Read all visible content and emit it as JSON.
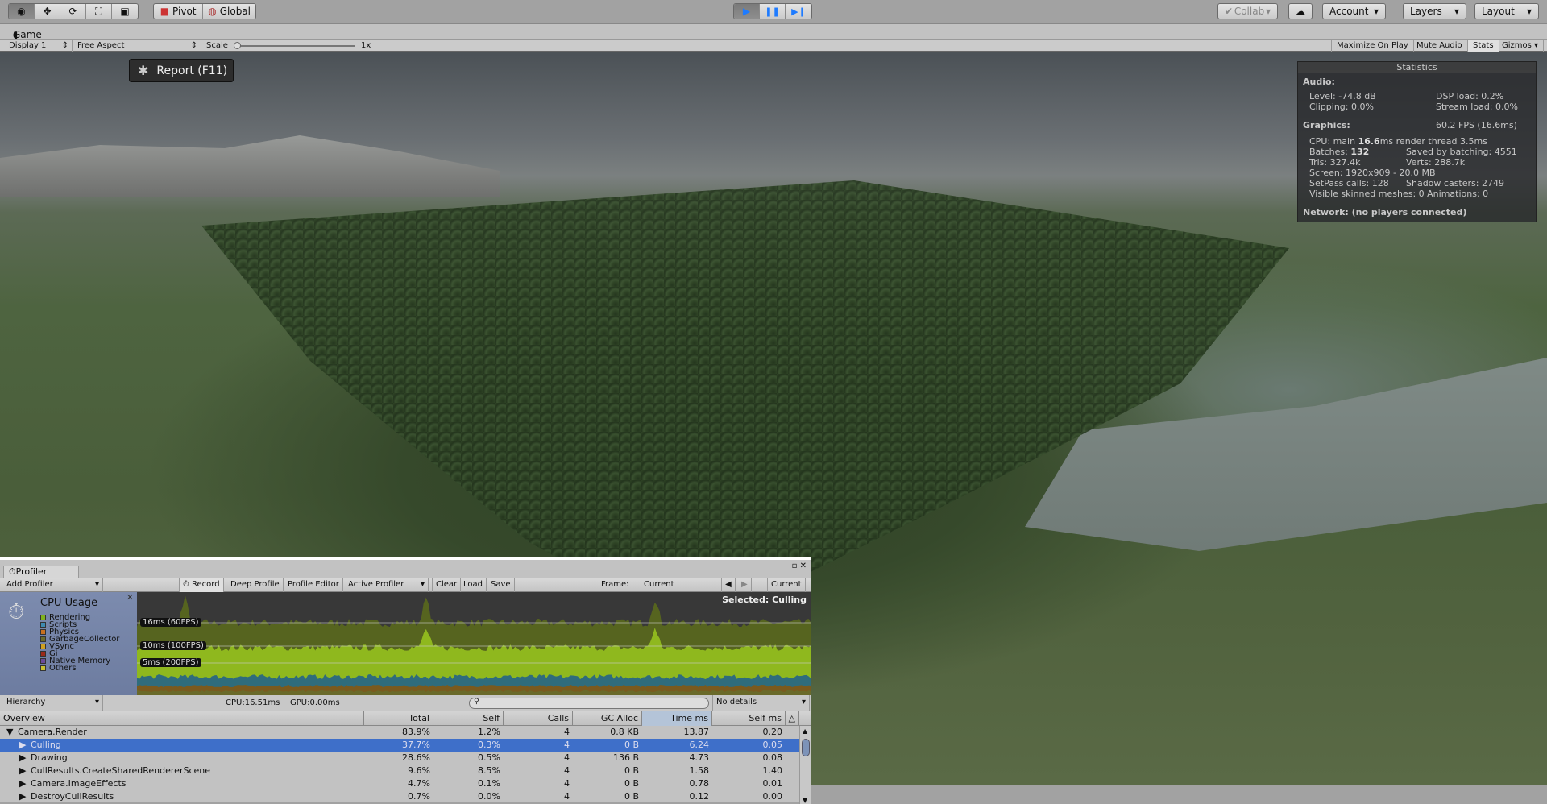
{
  "toolbar": {
    "tools": [
      {
        "name": "view-tool",
        "glyph": "◉"
      },
      {
        "name": "move-tool",
        "glyph": "✥"
      },
      {
        "name": "rotate-tool",
        "glyph": "⟳"
      },
      {
        "name": "scale-tool",
        "glyph": "⛶"
      },
      {
        "name": "rect-tool",
        "glyph": "▣"
      }
    ],
    "pivot": "Pivot",
    "global": "Global",
    "play": "▶",
    "pause": "❚❚",
    "step": "▶❙",
    "collab": "Collab",
    "account": "Account",
    "layers": "Layers",
    "layout": "Layout",
    "accent": "#1e7bff"
  },
  "game": {
    "tab": "Game",
    "display": "Display 1",
    "aspect": "Free Aspect",
    "scale_label": "Scale",
    "scale_value": "1x",
    "maximize": "Maximize On Play",
    "mute": "Mute Audio",
    "stats": "Stats",
    "gizmos": "Gizmos",
    "report": "Report (F11)"
  },
  "statistics": {
    "title": "Statistics",
    "audio": "Audio:",
    "level": "Level: -74.8 dB",
    "dsp": "DSP load: 0.2%",
    "clipping": "Clipping: 0.0%",
    "stream": "Stream load: 0.0%",
    "graphics": "Graphics:",
    "fps": "60.2 FPS (16.6ms)",
    "cpu_pre": "CPU: main ",
    "cpu_val": "16.6",
    "cpu_post": "ms  render thread 3.5ms",
    "batches_pre": "Batches: ",
    "batches_val": "132",
    "saved": "Saved by batching: 4551",
    "tris": "Tris: 327.4k",
    "verts": "Verts: 288.7k",
    "screen": "Screen: 1920x909 - 20.0 MB",
    "setpass": "SetPass calls: 128",
    "shadow": "Shadow casters: 2749",
    "skinned": "Visible skinned meshes: 0  Animations: 0",
    "network": "Network: (no players connected)"
  },
  "profiler": {
    "tab": "Profiler",
    "add": "Add Profiler",
    "record": "Record",
    "deep": "Deep Profile",
    "editor": "Profile Editor",
    "active": "Active Profiler",
    "clear": "Clear",
    "load": "Load",
    "save": "Save",
    "frame_label": "Frame:",
    "frame_value": "Current",
    "current": "Current",
    "cpu_title": "CPU Usage",
    "selected": "Selected: Culling",
    "legend": [
      {
        "label": "Rendering",
        "color": "#7fb21e"
      },
      {
        "label": "Scripts",
        "color": "#3e8ab0"
      },
      {
        "label": "Physics",
        "color": "#c8701e"
      },
      {
        "label": "GarbageCollector",
        "color": "#6a6a2a"
      },
      {
        "label": "VSync",
        "color": "#d0a020"
      },
      {
        "label": "Gi",
        "color": "#9a2a1a"
      },
      {
        "label": "Native Memory",
        "color": "#6a4a9a"
      },
      {
        "label": "Others",
        "color": "#c8c030"
      }
    ],
    "guides": [
      "16ms (60FPS)",
      "10ms (100FPS)",
      "5ms (200FPS)"
    ],
    "view": "Hierarchy",
    "cpu_time": "CPU:16.51ms",
    "gpu_time": "GPU:0.00ms",
    "search_placeholder": "",
    "details": "No details",
    "columns": [
      "Overview",
      "Total",
      "Self",
      "Calls",
      "GC Alloc",
      "Time ms",
      "Self ms"
    ],
    "rows": [
      {
        "name": "Camera.Render",
        "total": "83.9%",
        "self": "1.2%",
        "calls": "4",
        "gc": "0.8 KB",
        "time": "13.87",
        "selfms": "0.20",
        "expanded": true,
        "depth": 0
      },
      {
        "name": "Culling",
        "total": "37.7%",
        "self": "0.3%",
        "calls": "4",
        "gc": "0 B",
        "time": "6.24",
        "selfms": "0.05",
        "depth": 1,
        "selected": true
      },
      {
        "name": "Drawing",
        "total": "28.6%",
        "self": "0.5%",
        "calls": "4",
        "gc": "136 B",
        "time": "4.73",
        "selfms": "0.08",
        "depth": 1
      },
      {
        "name": "CullResults.CreateSharedRendererScene",
        "total": "9.6%",
        "self": "8.5%",
        "calls": "4",
        "gc": "0 B",
        "time": "1.58",
        "selfms": "1.40",
        "depth": 1
      },
      {
        "name": "Camera.ImageEffects",
        "total": "4.7%",
        "self": "0.1%",
        "calls": "4",
        "gc": "0 B",
        "time": "0.78",
        "selfms": "0.01",
        "depth": 1
      },
      {
        "name": "DestroyCullResults",
        "total": "0.7%",
        "self": "0.0%",
        "calls": "4",
        "gc": "0 B",
        "time": "0.12",
        "selfms": "0.00",
        "depth": 1
      }
    ]
  }
}
